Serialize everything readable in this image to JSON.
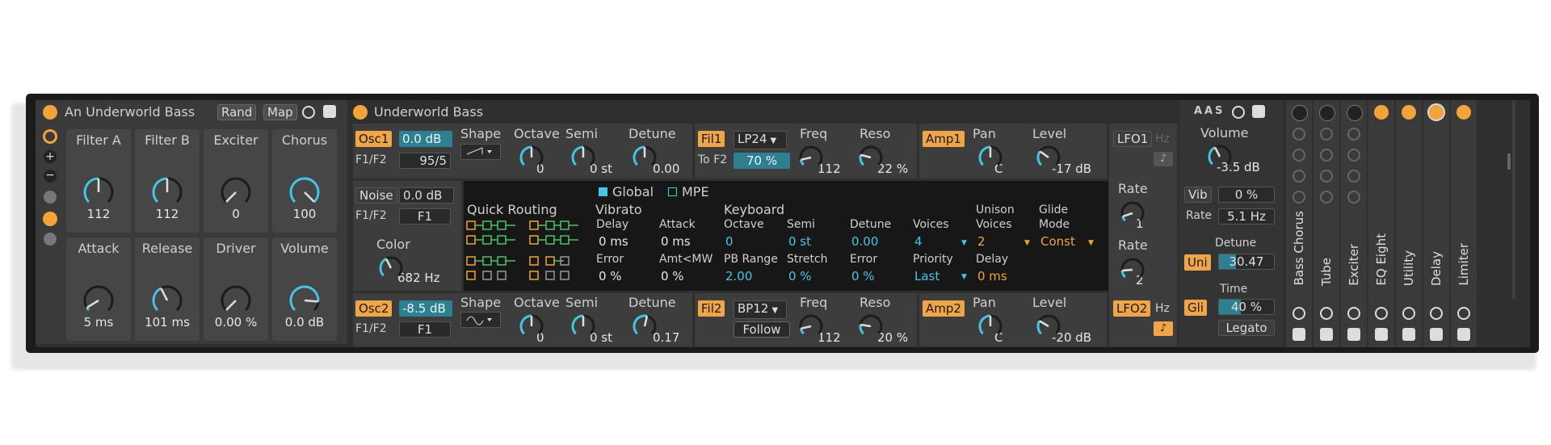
{
  "rack": {
    "title": "An Underworld Bass",
    "rand": "Rand",
    "map": "Map",
    "macros": [
      {
        "name": "Filter A",
        "value": "112",
        "level": 0.5
      },
      {
        "name": "Filter B",
        "value": "112",
        "level": 0.5
      },
      {
        "name": "Exciter",
        "value": "0",
        "level": 0.0
      },
      {
        "name": "Chorus",
        "value": "100",
        "level": 1.0
      },
      {
        "name": "Attack",
        "value": "5 ms",
        "level": 0.05
      },
      {
        "name": "Release",
        "value": "101 ms",
        "level": 0.4
      },
      {
        "name": "Driver",
        "value": "0.00 %",
        "level": 0.0
      },
      {
        "name": "Volume",
        "value": "0.0 dB",
        "level": 0.85
      }
    ]
  },
  "synth": {
    "title": "Underworld Bass",
    "osc1": {
      "label": "Osc1",
      "gain": "0.0 dB",
      "f1f2": "F1/F2",
      "f1f2_value": "95/5",
      "shape": "Shape",
      "octave": "Octave",
      "octave_value": "0",
      "semi": "Semi",
      "semi_value": "0 st",
      "detune": "Detune",
      "detune_value": "0.00"
    },
    "noise": {
      "label": "Noise",
      "gain": "0.0 dB",
      "f1f2": "F1/F2",
      "f1f2_value": "F1",
      "color": "Color",
      "color_value": "682 Hz"
    },
    "osc2": {
      "label": "Osc2",
      "gain": "-8.5 dB",
      "f1f2": "F1/F2",
      "f1f2_value": "F1",
      "shape": "Shape",
      "octave": "Octave",
      "octave_value": "0",
      "semi": "Semi",
      "semi_value": "0 st",
      "detune": "Detune",
      "detune_value": "0.17"
    },
    "fil1": {
      "label": "Fil1",
      "type": "LP24",
      "tof2": "To F2",
      "tof2_value": "70 %",
      "freq": "Freq",
      "freq_value": "112",
      "reso": "Reso",
      "reso_value": "22 %"
    },
    "fil2": {
      "label": "Fil2",
      "type": "BP12",
      "follow": "Follow",
      "freq": "Freq",
      "freq_value": "112",
      "reso": "Reso",
      "reso_value": "20 %"
    },
    "amp1": {
      "label": "Amp1",
      "pan": "Pan",
      "pan_value": "C",
      "level": "Level",
      "level_value": "-17 dB"
    },
    "amp2": {
      "label": "Amp2",
      "pan": "Pan",
      "pan_value": "C",
      "level": "Level",
      "level_value": "-20 dB"
    },
    "lfo1": {
      "label": "LFO1",
      "hz": "Hz",
      "rate": "Rate",
      "rate_value": "1"
    },
    "lfo2": {
      "label": "LFO2",
      "hz": "Hz",
      "rate": "Rate",
      "rate_value": "2"
    },
    "center": {
      "global": "Global",
      "mpe": "MPE",
      "quick_routing": "Quick Routing",
      "vibrato": "Vibrato",
      "delay": "Delay",
      "delay_value": "0 ms",
      "attack": "Attack",
      "attack_value": "0 ms",
      "error": "Error",
      "error_value": "0 %",
      "amt_mw": "Amt<MW",
      "amt_mw_value": "0 %",
      "keyboard": "Keyboard",
      "octave": "Octave",
      "octave_value": "0",
      "semi": "Semi",
      "semi_value": "0 st",
      "detune": "Detune",
      "detune_value": "0.00",
      "pb_range": "PB Range",
      "pb_range_value": "2.00",
      "stretch": "Stretch",
      "stretch_value": "0 %",
      "kerror": "Error",
      "kerror_value": "0 %",
      "voices": "Voices",
      "voices_value": "4",
      "priority": "Priority",
      "priority_value": "Last",
      "unison_voices_1": "Unison",
      "unison_voices_2": "Voices",
      "unison_voices_value": "2",
      "udelay": "Delay",
      "udelay_value": "0 ms",
      "glide_1": "Glide",
      "glide_2": "Mode",
      "glide_value": "Const"
    },
    "right": {
      "volume": "Volume",
      "volume_value": "-3.5 dB",
      "vib": "Vib",
      "vib_value": "0 %",
      "rate": "Rate",
      "rate_value": "5.1 Hz",
      "detune": "Detune",
      "uni": "Uni",
      "uni_value": "30.47",
      "time": "Time",
      "gli": "Gli",
      "gli_value": "40 %",
      "legato": "Legato",
      "header_letters": [
        "A",
        "A",
        "S"
      ]
    }
  },
  "chain": [
    {
      "name": "Bass Chorus"
    },
    {
      "name": "Tube"
    },
    {
      "name": "Exciter"
    },
    {
      "name": "EQ Eight"
    },
    {
      "name": "Utility"
    },
    {
      "name": "Delay"
    },
    {
      "name": "Limiter"
    }
  ],
  "colors": {
    "accent": "#f2a33a",
    "blue": "#47c5e6",
    "panel": "#3d3d3d",
    "background": "#2f2f2f"
  }
}
